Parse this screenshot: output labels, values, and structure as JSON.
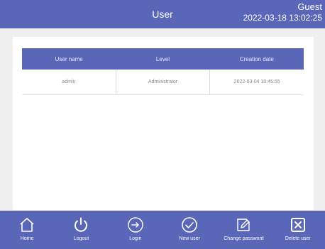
{
  "header": {
    "title": "User",
    "current_user": "Guest",
    "datetime": "2022-03-18 13:02:25"
  },
  "table": {
    "columns": [
      "User name",
      "Level",
      "Creation date"
    ],
    "rows": [
      [
        "admin",
        "Administrator",
        "2022-03-04 10:45:55"
      ]
    ]
  },
  "toolbar": {
    "items": [
      {
        "label": "Home",
        "icon": "home-icon"
      },
      {
        "label": "Logout",
        "icon": "power-icon"
      },
      {
        "label": "Login",
        "icon": "login-arrow-icon"
      },
      {
        "label": "New user",
        "icon": "check-circle-icon"
      },
      {
        "label": "Change password",
        "icon": "edit-icon"
      },
      {
        "label": "Delete user",
        "icon": "delete-x-icon"
      }
    ]
  },
  "colors": {
    "accent": "#5a66b8",
    "panel": "#ffffff",
    "background": "#f0f0f0"
  }
}
